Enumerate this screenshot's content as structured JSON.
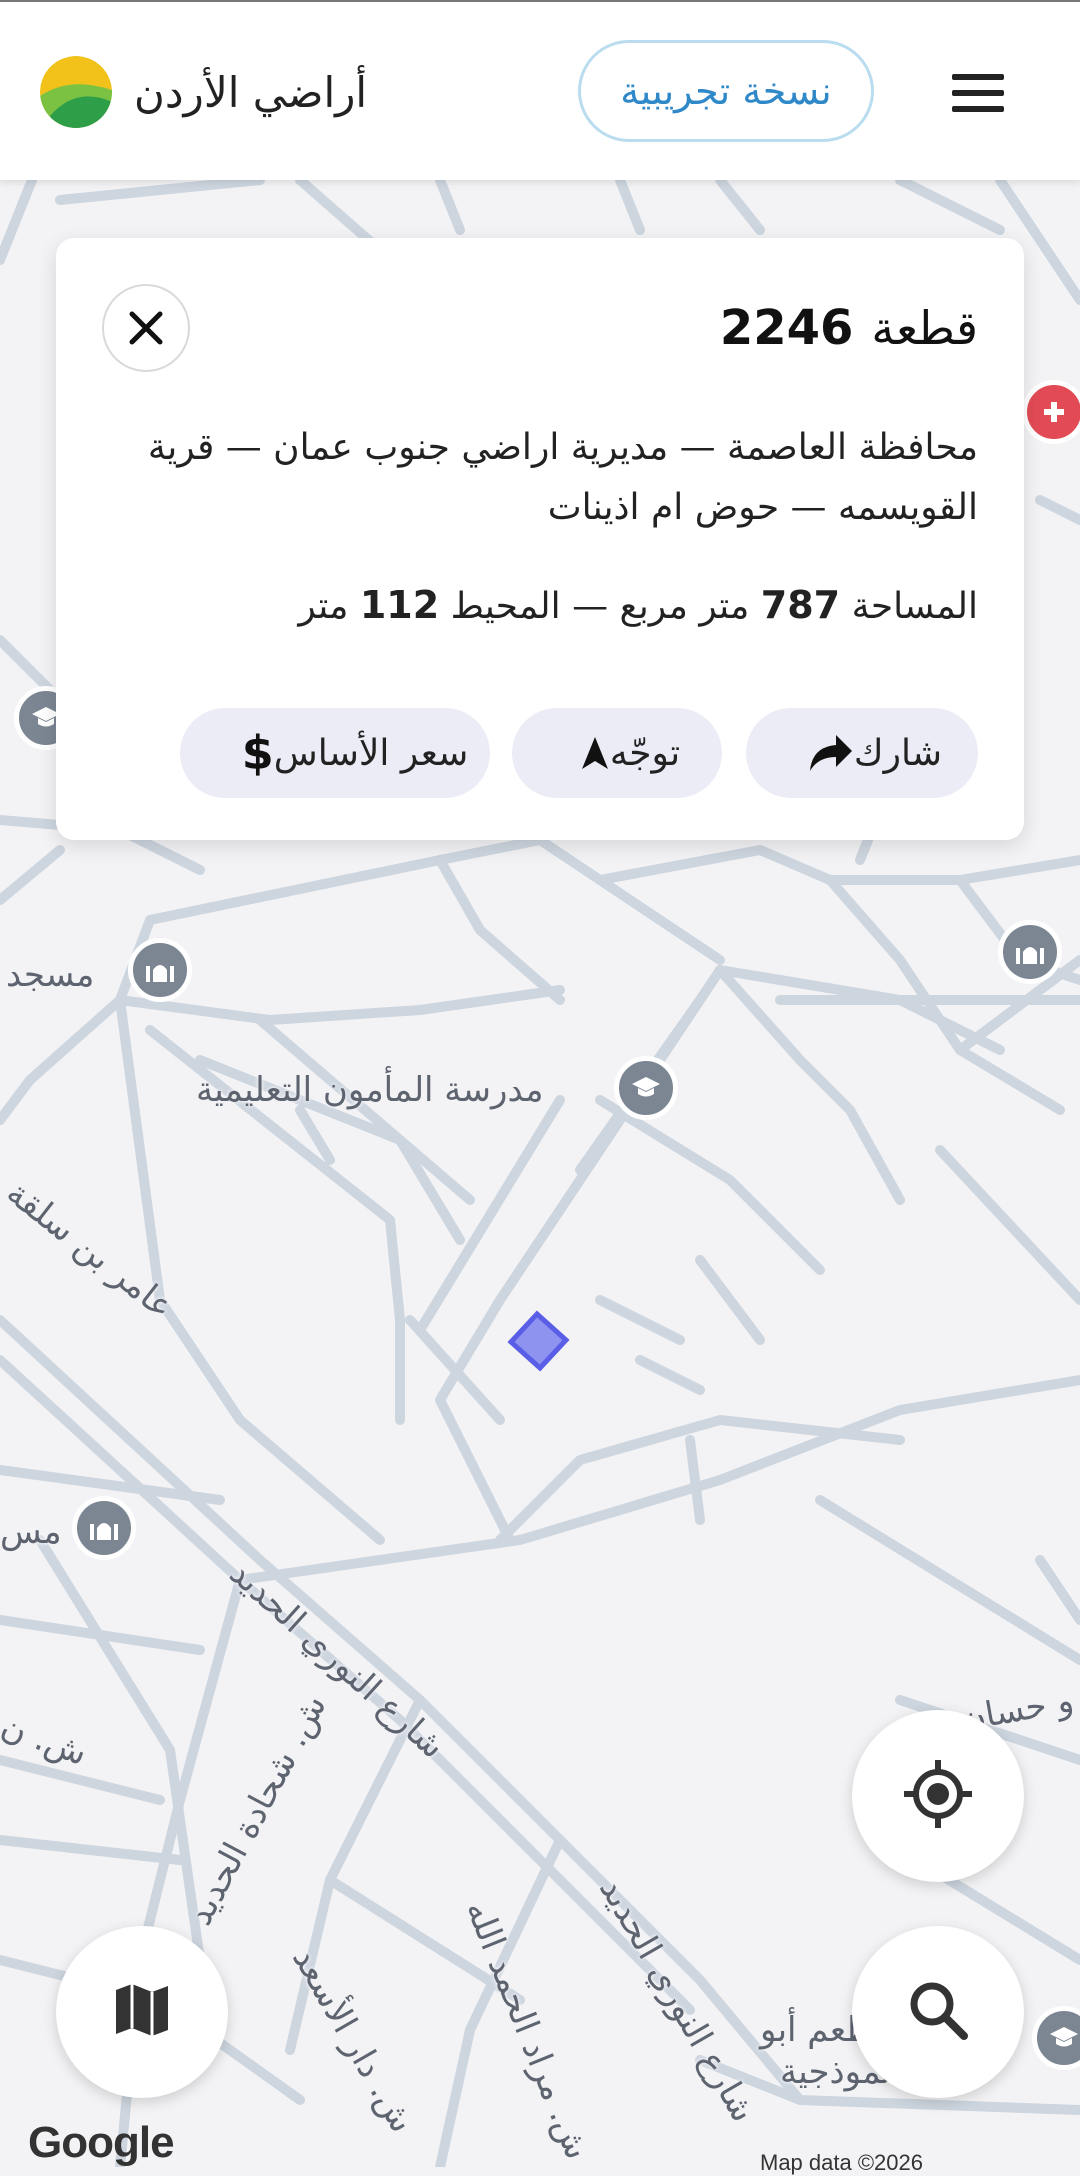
{
  "header": {
    "brand_name": "أراضي الأردن",
    "beta_label": "نسخة تجريبية"
  },
  "parcel": {
    "title_word": "قطعة",
    "number": "2246",
    "address": "محافظة العاصمة — مديرية اراضي جنوب عمان — قرية القويسمه — حوض ام اذينات",
    "area_label": "المساحة",
    "area_value": "787",
    "area_unit": "متر مربع —",
    "perimeter_label": "المحيط",
    "perimeter_value": "112",
    "perimeter_unit": "متر",
    "actions": {
      "share": "شارك",
      "navigate": "توجّه",
      "base_price": "سعر الأساس"
    }
  },
  "map": {
    "labels": {
      "school": "مدرسة المأمون التعليمية",
      "mosque_left": "مسجد",
      "mosque_left2": "مس",
      "street_amer": "عامر بن سلقة",
      "street_nouri": "شارع النوري الحديد",
      "street_nouri2": "شارع النوري الحديد",
      "street_shahada": "ش. شحادة الحديد",
      "street_dar": "ش. دار الأسعد",
      "street_murad": "ش. مراد الحمد الله",
      "street_na": "ش. ن",
      "street_hassan": "و حسان",
      "place_abu": "طعم أبو",
      "place_model": "نموذجية"
    },
    "attribution": "Google",
    "map_data": "Map data ©2026"
  },
  "icons": {
    "menu": "hamburger-icon",
    "close": "close-icon",
    "share": "share-arrow-icon",
    "navigate": "navigation-arrow-icon",
    "price": "dollar-icon",
    "locate": "my-location-icon",
    "search": "search-icon",
    "layers": "map-icon",
    "school": "school-icon",
    "mosque": "mosque-icon"
  },
  "colors": {
    "accent": "#2f88c8",
    "parcel_fill": "#8f93f0",
    "parcel_stroke": "#5a5ee6",
    "road": "#cdd5df"
  }
}
